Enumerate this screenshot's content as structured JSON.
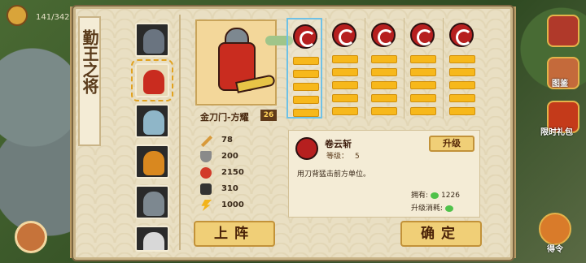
{
  "hud": {
    "progress": "141/342"
  },
  "side": {
    "dictionary": "图鉴",
    "gift": "限时礼包",
    "order": "得令"
  },
  "panel": {
    "title": "勤王之将",
    "hero_name": "金刀门-方耀",
    "hero_level": "26",
    "stats": [
      {
        "icon": "sword-icon",
        "value": "78"
      },
      {
        "icon": "shield-icon",
        "value": "200"
      },
      {
        "icon": "heart-icon",
        "value": "2150"
      },
      {
        "icon": "boot-icon",
        "value": "310"
      },
      {
        "icon": "lightning-icon",
        "value": "1000"
      }
    ],
    "skill": {
      "name": "卷云斩",
      "level_label": "等级：",
      "level_value": "5",
      "upgrade_label": "升级",
      "description": "用刀背猛击前方单位。",
      "own_label": "拥有:",
      "own_value": "1226",
      "cost_label": "升级消耗:"
    },
    "deploy_button": "上阵",
    "confirm_button": "确定"
  },
  "colors": {
    "accent": "#f7b81b",
    "panel_bg": "#e9dfc3",
    "skill_red": "#b61f1f"
  }
}
